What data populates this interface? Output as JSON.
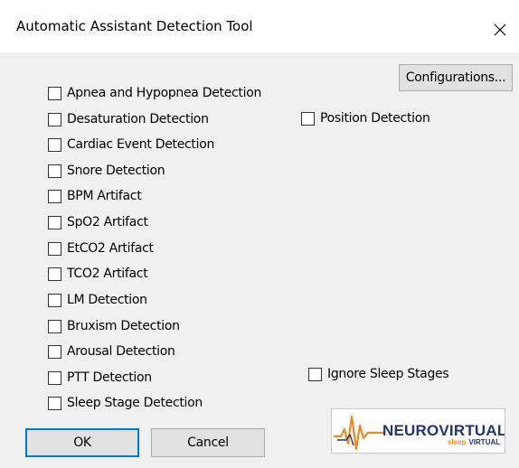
{
  "window": {
    "title": "Automatic Assistant Detection Tool",
    "close_glyph": "close-icon"
  },
  "buttons": {
    "configurations": "Configurations...",
    "ok": "OK",
    "cancel": "Cancel"
  },
  "checkboxes": [
    {
      "label": "Apnea and Hypopnea Detection",
      "checked": false
    },
    {
      "label": "Desaturation Detection",
      "checked": false
    },
    {
      "label": "Cardiac Event Detection",
      "checked": false
    },
    {
      "label": "Snore Detection",
      "checked": false
    },
    {
      "label": "BPM Artifact",
      "checked": false
    },
    {
      "label": "SpO2 Artifact",
      "checked": false
    },
    {
      "label": "EtCO2 Artifact",
      "checked": false
    },
    {
      "label": "TCO2 Artifact",
      "checked": false
    },
    {
      "label": "LM Detection",
      "checked": false
    },
    {
      "label": "Bruxism Detection",
      "checked": false
    },
    {
      "label": "Arousal Detection",
      "checked": false
    },
    {
      "label": "PTT Detection",
      "checked": false
    },
    {
      "label": "Sleep Stage Detection",
      "checked": false
    }
  ],
  "right_checkboxes": {
    "position": {
      "label": "Position Detection",
      "checked": false
    },
    "ignore_sleep_stages": {
      "label": "Ignore Sleep Stages",
      "checked": false
    }
  },
  "logo": {
    "brand": "NEUROVIRTUAL",
    "tagline_part1": "sleep",
    "tagline_part2": "VIRTUAL"
  },
  "colors": {
    "default_button_border": "#0078d7",
    "logo_navy": "#23356e",
    "logo_orange": "#f08a1c"
  }
}
